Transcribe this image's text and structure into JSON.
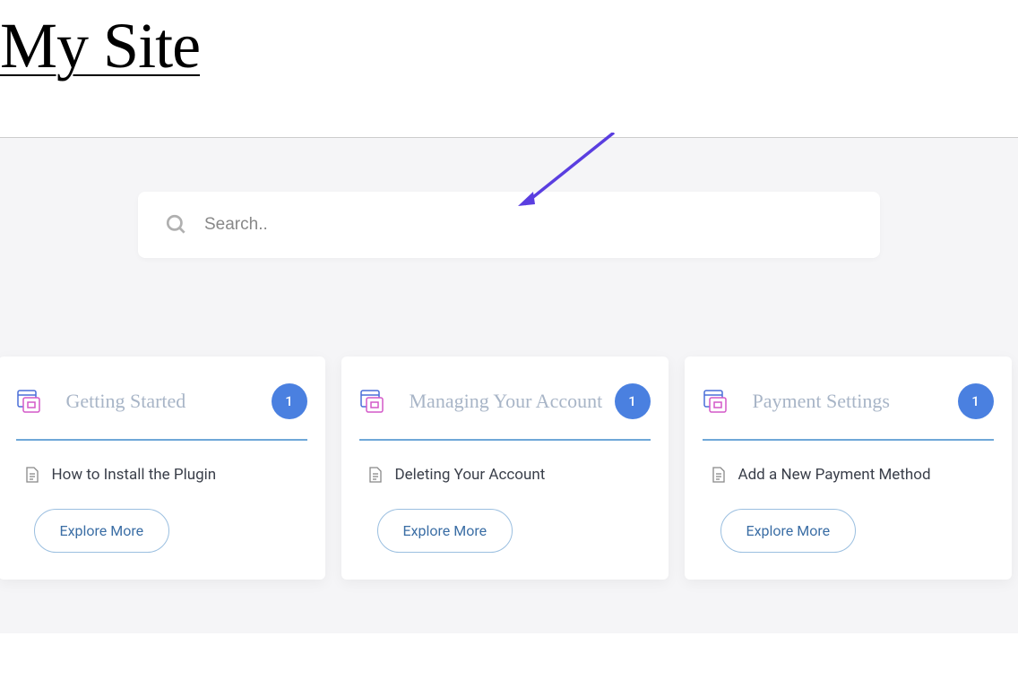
{
  "header": {
    "site_title": "My Site"
  },
  "search": {
    "placeholder": "Search.."
  },
  "cards": [
    {
      "title": "Getting Started",
      "badge": "1",
      "item": "How to Install the Plugin",
      "button": "Explore More"
    },
    {
      "title": "Managing Your Account",
      "badge": "1",
      "item": "Deleting Your Account",
      "button": "Explore More"
    },
    {
      "title": "Payment Settings",
      "badge": "1",
      "item": "Add a New Payment Method",
      "button": "Explore More"
    }
  ]
}
